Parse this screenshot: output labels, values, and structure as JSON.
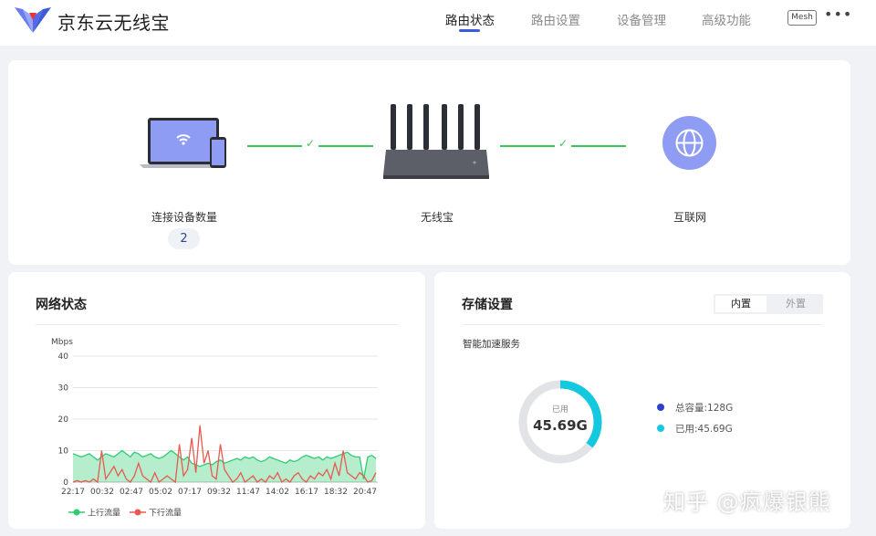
{
  "header": {
    "brand": "京东云无线宝",
    "nav": [
      {
        "label": "路由状态",
        "active": true
      },
      {
        "label": "路由设置",
        "active": false
      },
      {
        "label": "设备管理",
        "active": false
      },
      {
        "label": "高级功能",
        "active": false
      }
    ],
    "mesh_label": "Mesh",
    "more_label": "•••"
  },
  "topology": {
    "devices_label": "连接设备数量",
    "devices_count": "2",
    "router_label": "无线宝",
    "internet_label": "互联网",
    "check_glyph": "✓"
  },
  "network": {
    "title": "网络状态",
    "y_unit": "Mbps"
  },
  "storage": {
    "title": "存储设置",
    "tabs": [
      "内置",
      "外置"
    ],
    "subtitle": "智能加速服务",
    "donut_label": "已用",
    "donut_value": "45.69G",
    "used_fraction": 0.357,
    "legend": [
      {
        "label": "总容量:128G",
        "color": "#2f3fcf"
      },
      {
        "label": "已用:45.69G",
        "color": "#14c8e0"
      }
    ]
  },
  "watermark": "知乎 @疯爆银熊",
  "colors": {
    "accent": "#3b5bdb",
    "upload": "#2ecc71",
    "download": "#e85a4f",
    "line_ok": "#38c75a"
  },
  "chart_data": {
    "type": "line",
    "ylabel": "Mbps",
    "ylim": [
      0,
      40
    ],
    "yticks": [
      0,
      10,
      20,
      30,
      40
    ],
    "x_tick_labels": [
      "22:17",
      "00:32",
      "02:47",
      "05:02",
      "07:17",
      "09:32",
      "11:47",
      "14:02",
      "16:17",
      "18:32",
      "20:47"
    ],
    "series": [
      {
        "name": "上行流量",
        "color": "#2ecc71",
        "fill": true,
        "values": [
          9,
          8.5,
          8,
          8.5,
          9,
          8,
          7,
          8,
          9,
          8.5,
          8,
          9,
          10,
          9,
          8,
          9.5,
          9,
          8,
          8.5,
          9,
          8,
          7.5,
          8,
          9,
          10,
          9,
          8,
          7,
          8,
          6,
          5.5,
          5,
          5.5,
          6,
          5.5,
          6.5,
          7,
          6,
          6.5,
          7,
          7.5,
          7,
          8,
          7.5,
          8,
          7,
          6.5,
          7,
          8,
          7.5,
          7,
          6.5,
          6,
          7,
          6.5,
          7,
          8,
          8.5,
          8,
          7.5,
          8,
          7,
          8,
          7.5,
          8,
          8.5,
          9,
          9.5,
          8.5,
          8,
          8,
          1,
          8,
          8.5,
          7.5
        ]
      },
      {
        "name": "下行流量",
        "color": "#e85a4f",
        "fill": false,
        "values": [
          0,
          0.5,
          0,
          0.5,
          0,
          1,
          0,
          10,
          1,
          3,
          5,
          2,
          4,
          1,
          0,
          2,
          6,
          2,
          1,
          0,
          3,
          0,
          1,
          2,
          1,
          0,
          12,
          2,
          4,
          14,
          3,
          18,
          6,
          10,
          2,
          1,
          12,
          4,
          2,
          0,
          1,
          3,
          0,
          1,
          2,
          0,
          1,
          0,
          2,
          1,
          3,
          0,
          1,
          0,
          2,
          3,
          1,
          0,
          2,
          1,
          3,
          2,
          4,
          1,
          6,
          2,
          10,
          3,
          2,
          1,
          3,
          2,
          0,
          0.5,
          3
        ]
      }
    ]
  }
}
